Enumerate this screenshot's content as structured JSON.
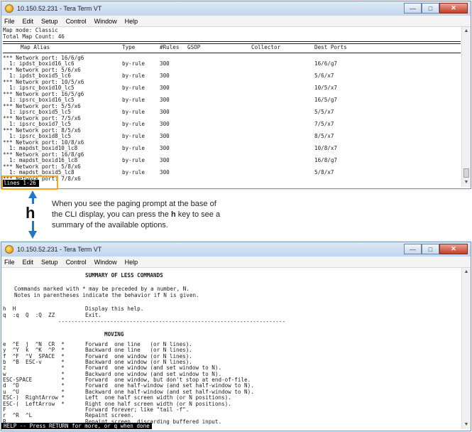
{
  "top": {
    "title": "10.150.52.231 - Tera Term VT",
    "menu": [
      "File",
      "Edit",
      "Setup",
      "Control",
      "Window",
      "Help"
    ],
    "lines": [
      "Map mode: Classic",
      "Total Map Count: 46"
    ],
    "headers": {
      "alias": "Map Alias",
      "type": "Type",
      "rules": "#Rules",
      "gsop": "GSOP",
      "collector": "Collector",
      "dest": "Dest Ports"
    },
    "rows": [
      {
        "port": "*** Network port: 16/6/g6",
        "alias": "  1: ipdst_boxid16_lc6",
        "type": "by-rule",
        "rules": "300",
        "dest": "16/6/g7"
      },
      {
        "port": "*** Network port: 5/6/x6",
        "alias": "  1: ipdst_boxid5_lc6",
        "type": "by-rule",
        "rules": "300",
        "dest": "5/6/x7"
      },
      {
        "port": "*** Network port: 10/5/x6",
        "alias": "  1: ipsrc_boxid10_lc5",
        "type": "by-rule",
        "rules": "300",
        "dest": "10/5/x7"
      },
      {
        "port": "*** Network port: 16/5/g6",
        "alias": "  1: ipsrc_boxid16_lc5",
        "type": "by-rule",
        "rules": "300",
        "dest": "16/5/g7"
      },
      {
        "port": "*** Network port: 5/5/x6",
        "alias": "  1: ipsrc_boxid5_lc5",
        "type": "by-rule",
        "rules": "300",
        "dest": "5/5/x7"
      },
      {
        "port": "*** Network port: 7/5/x6",
        "alias": "  1: ipsrc_boxid7_lc5",
        "type": "by-rule",
        "rules": "300",
        "dest": "7/5/x7"
      },
      {
        "port": "*** Network port: 8/5/x6",
        "alias": "  1: ipsrc_boxid8_lc5",
        "type": "by-rule",
        "rules": "300",
        "dest": "8/5/x7"
      },
      {
        "port": "*** Network port: 10/8/x6",
        "alias": "  1: mapdst_boxid10_lc8",
        "type": "by-rule",
        "rules": "300",
        "dest": "10/8/x7"
      },
      {
        "port": "*** Network port: 16/8/g6",
        "alias": "  1: mapdst_boxid16_lc8",
        "type": "by-rule",
        "rules": "300",
        "dest": "16/8/g7"
      },
      {
        "port": "*** Network port: 5/8/x6",
        "alias": "  1: mapdst_boxid5_lc8",
        "type": "by-rule",
        "rules": "300",
        "dest": "5/8/x7"
      }
    ],
    "last_partial": "*** Network port: 7/8/x6",
    "prompt": "lines 1-26"
  },
  "callout": {
    "key": "h",
    "text_before": "When you see the paging prompt at the base of the CLI display, you can press the ",
    "key_inline": "h",
    "text_after": " key to see a summary of the available options."
  },
  "bottom": {
    "title": "10.150.52.231 - Tera Term VT",
    "menu": [
      "File",
      "Edit",
      "Setup",
      "Control",
      "Window",
      "Help"
    ],
    "summary_title": "SUMMARY OF LESS COMMANDS",
    "note1": "Commands marked with * may be preceded by a number, N.",
    "note2": "Notes in parentheses indicate the behavior if N is given.",
    "help_rows": [
      {
        "keys": "h  H",
        "desc": "Display this help."
      },
      {
        "keys": "q  :q  Q  :Q  ZZ",
        "desc": "Exit."
      }
    ],
    "divider": "----------------------------------------------------------------------",
    "moving_title": "MOVING",
    "moving_rows": [
      {
        "keys": "e  ^E  j  ^N  CR  *",
        "desc": "Forward  one line   (or N lines)."
      },
      {
        "keys": "y  ^Y  k  ^K  ^P  *",
        "desc": "Backward one line   (or N lines)."
      },
      {
        "keys": "f  ^F  ^V  SPACE  *",
        "desc": "Forward  one window (or N lines)."
      },
      {
        "keys": "b  ^B  ESC-v      *",
        "desc": "Backward one window (or N lines)."
      },
      {
        "keys": "z                 *",
        "desc": "Forward  one window (and set window to N)."
      },
      {
        "keys": "w                 *",
        "desc": "Backward one window (and set window to N)."
      },
      {
        "keys": "ESC-SPACE         *",
        "desc": "Forward  one window, but don't stop at end-of-file."
      },
      {
        "keys": "d  ^D             *",
        "desc": "Forward  one half-window (and set half-window to N)."
      },
      {
        "keys": "u  ^U             *",
        "desc": "Backward one half-window (and set half-window to N)."
      },
      {
        "keys": "ESC-)  RightArrow *",
        "desc": "Left  one half screen width (or N positions)."
      },
      {
        "keys": "ESC-(  LeftArrow  *",
        "desc": "Right one half screen width (or N positions)."
      },
      {
        "keys": "F",
        "desc": "Forward forever; like \"tail -f\"."
      },
      {
        "keys": "r  ^R  ^L",
        "desc": "Repaint screen."
      },
      {
        "keys": "R",
        "desc": "Repaint screen, discarding buffered input."
      }
    ],
    "status": "HELP -- Press RETURN for more, or q when done"
  },
  "colors": {
    "accent": "#f5a623",
    "arrow": "#1f78c8",
    "titlebar": "#c3d6ee",
    "close": "#c43d27"
  },
  "icons": [
    "tera-term-icon",
    "minimize-icon",
    "maximize-icon",
    "close-icon",
    "scroll-up-icon",
    "scroll-down-icon"
  ]
}
